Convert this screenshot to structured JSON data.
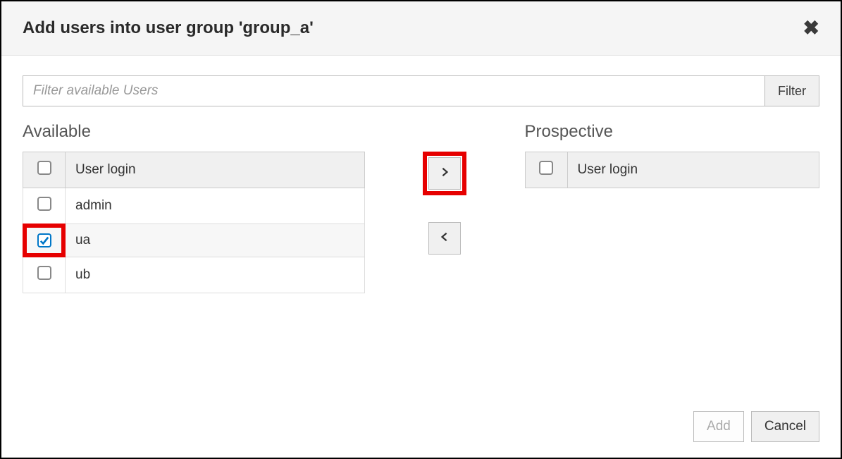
{
  "dialog": {
    "title": "Add users into user group 'group_a'"
  },
  "filter": {
    "placeholder": "Filter available Users",
    "button_label": "Filter"
  },
  "available": {
    "heading": "Available",
    "column_label": "User login",
    "rows": [
      {
        "login": "admin",
        "checked": false
      },
      {
        "login": "ua",
        "checked": true
      },
      {
        "login": "ub",
        "checked": false
      }
    ]
  },
  "prospective": {
    "heading": "Prospective",
    "column_label": "User login",
    "rows": []
  },
  "footer": {
    "add_label": "Add",
    "cancel_label": "Cancel"
  }
}
